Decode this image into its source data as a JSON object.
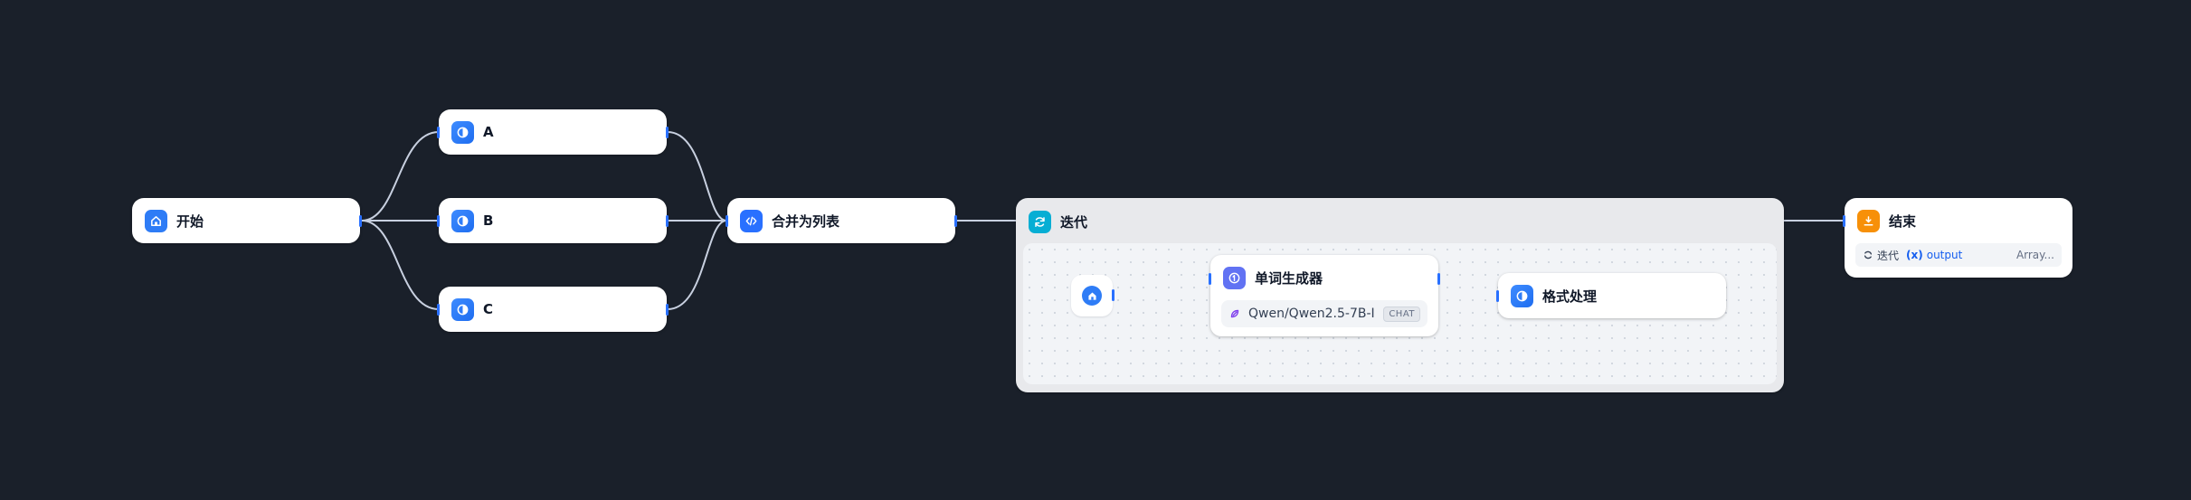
{
  "workflow": {
    "start": {
      "title": "开始",
      "icon": "home-icon"
    },
    "nodes_llm": [
      {
        "title": "A",
        "icon": "llm-icon"
      },
      {
        "title": "B",
        "icon": "llm-icon"
      },
      {
        "title": "C",
        "icon": "llm-icon"
      }
    ],
    "merge": {
      "title": "合并为列表",
      "icon": "code-icon"
    },
    "iteration": {
      "title": "迭代",
      "icon": "iteration-icon",
      "sub_start_icon": "home-icon",
      "generator": {
        "title": "单词生成器",
        "icon": "agent-icon",
        "model_name": "Qwen/Qwen2.5-7B-I...",
        "model_badge": "CHAT",
        "model_icon": "model-provider-icon"
      },
      "format": {
        "title": "格式处理",
        "icon": "llm-icon"
      }
    },
    "end": {
      "title": "结束",
      "icon": "end-icon",
      "output_var": {
        "node": "迭代",
        "var_symbol": "(x)",
        "name": "output",
        "type": "Array..."
      }
    }
  },
  "colors": {
    "canvas_bg": "#1a202a",
    "edge": "#c8d0e0",
    "handle": "#2970ff",
    "start_icon": "#2e7cf6",
    "iteration_icon": "#06aed4",
    "end_icon": "#f79009",
    "agent_icon": "#6172f3"
  }
}
